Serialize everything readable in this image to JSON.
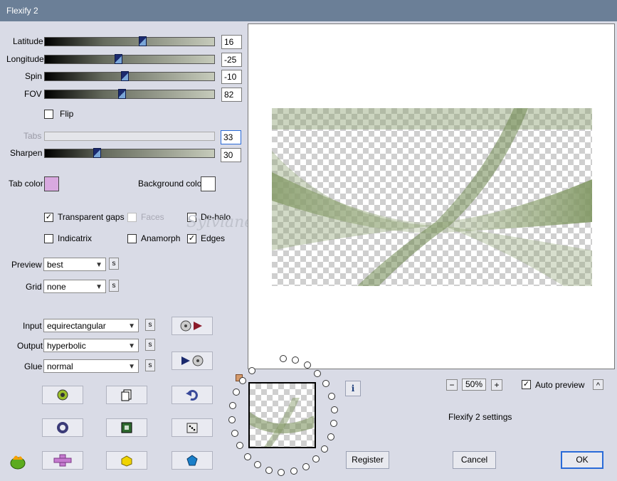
{
  "window": {
    "title": "Flexify 2"
  },
  "sliders": [
    {
      "label": "Latitude",
      "value": "16",
      "level": 0.58
    },
    {
      "label": "Longitude",
      "value": "-25",
      "level": 0.43
    },
    {
      "label": "Spin",
      "value": "-10",
      "level": 0.47
    },
    {
      "label": "FOV",
      "value": "82",
      "level": 0.45
    }
  ],
  "flip": {
    "label": "Flip",
    "checked": false
  },
  "tabs": {
    "label": "Tabs",
    "value": "33"
  },
  "sharpen": {
    "label": "Sharpen",
    "value": "30",
    "level": 0.3
  },
  "colors": {
    "tab_label": "Tab color",
    "tab_color": "#d9a9e0",
    "bg_label": "Background color",
    "bg_color": "#ffffff"
  },
  "options": [
    {
      "label": "Transparent gaps",
      "checked": true,
      "disabled": false
    },
    {
      "label": "Faces",
      "checked": false,
      "disabled": true
    },
    {
      "label": "De-halo",
      "checked": false,
      "disabled": false
    },
    {
      "label": "Indicatrix",
      "checked": false,
      "disabled": false
    },
    {
      "label": "Anamorph",
      "checked": false,
      "disabled": false
    },
    {
      "label": "Edges",
      "checked": true,
      "disabled": false
    }
  ],
  "preview_select": {
    "label": "Preview",
    "value": "best"
  },
  "grid_select": {
    "label": "Grid",
    "value": "none"
  },
  "input_select": {
    "label": "Input",
    "value": "equirectangular"
  },
  "output_select": {
    "label": "Output",
    "value": "hyperbolic"
  },
  "glue_select": {
    "label": "Glue",
    "value": "normal"
  },
  "s_label": "s",
  "watermark": "Sylviane",
  "zoom": {
    "value": "50%",
    "minus": "−",
    "plus": "+"
  },
  "auto_preview": {
    "label": "Auto preview",
    "checked": true
  },
  "collapse_label": "^",
  "settings_label": "Flexify 2 settings",
  "buttons": {
    "register": "Register",
    "cancel": "Cancel",
    "ok": "OK"
  },
  "info_label": "i"
}
